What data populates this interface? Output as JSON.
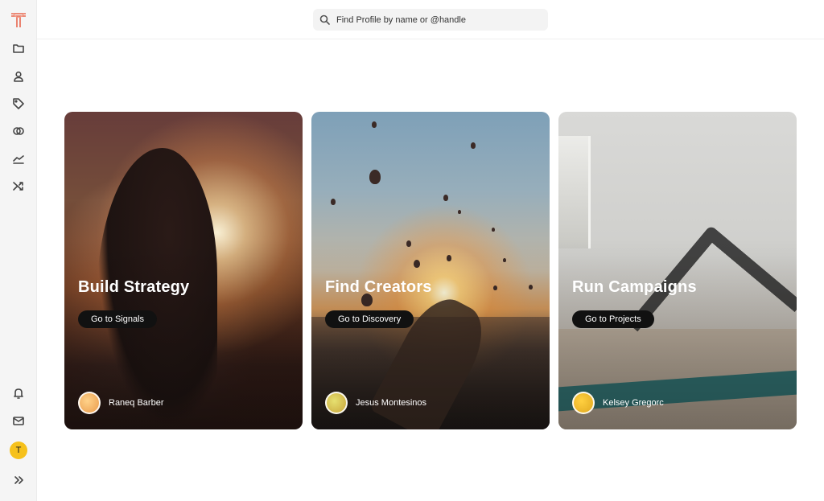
{
  "sidebar": {
    "logo": "T",
    "items": [
      {
        "icon": "folder-icon"
      },
      {
        "icon": "user-icon"
      },
      {
        "icon": "tag-icon"
      },
      {
        "icon": "overlap-circles-icon"
      },
      {
        "icon": "trend-line-icon"
      },
      {
        "icon": "shuffle-icon"
      }
    ],
    "bottom": [
      {
        "icon": "bell-icon"
      },
      {
        "icon": "mail-icon"
      },
      {
        "icon": "chevrons-right-icon"
      }
    ],
    "user_initial": "T"
  },
  "search": {
    "placeholder": "Find Profile by name or @handle"
  },
  "cards": [
    {
      "title": "Build Strategy",
      "button": "Go to Signals",
      "author": "Raneq Barber",
      "avatar_color": "#f5b56a"
    },
    {
      "title": "Find Creators",
      "button": "Go to Discovery",
      "author": "Jesus Montesinos",
      "avatar_color": "#d8c24a"
    },
    {
      "title": "Run Campaigns",
      "button": "Go to Projects",
      "author": "Kelsey Gregorc",
      "avatar_color": "#f2c230"
    }
  ],
  "colors": {
    "accent": "#f6c11b",
    "logo": "#e8674f",
    "button_bg": "#111111"
  }
}
